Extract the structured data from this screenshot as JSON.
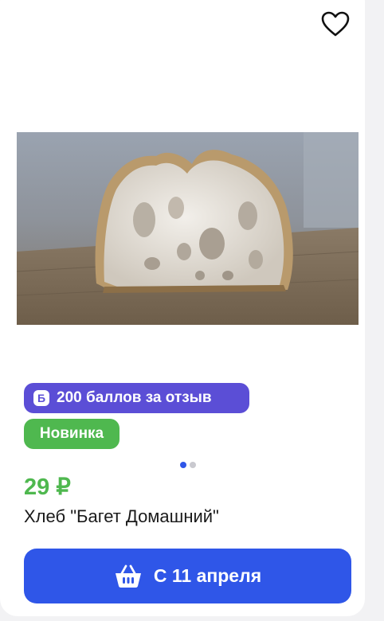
{
  "product": {
    "favorite_icon": "heart-outline-icon",
    "image_alt": "bread-baguette-photo",
    "reviews_badge": {
      "icon_letter": "Б",
      "label": "200 баллов за отзыв",
      "color": "#5b4ed6"
    },
    "new_badge": {
      "label": "Новинка",
      "color": "#4fb84f"
    },
    "carousel": {
      "count": 2,
      "active": 1
    },
    "price": "29 ₽",
    "title": "Хлеб \"Багет Домашний\"",
    "cart_button": {
      "icon": "basket-icon",
      "label": "С 11 апреля",
      "color": "#2f56e8"
    }
  }
}
